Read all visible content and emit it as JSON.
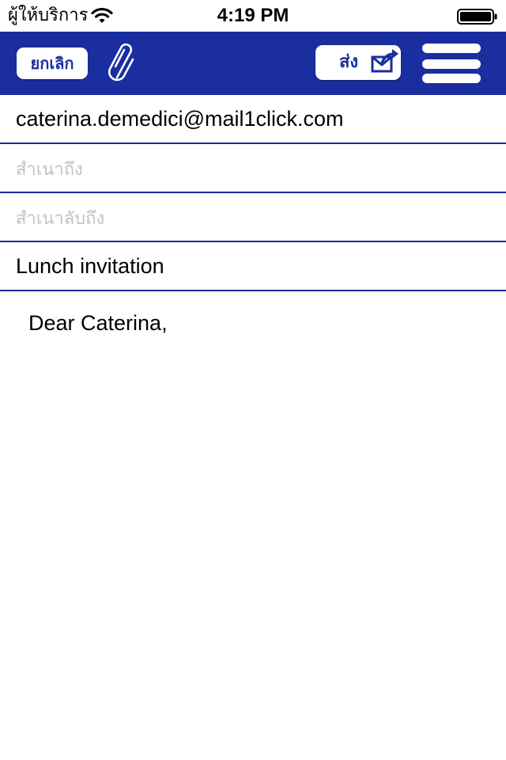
{
  "status_bar": {
    "carrier": "ผู้ให้บริการ",
    "time": "4:19 PM",
    "wifi_icon": "wifi-icon",
    "battery_icon": "battery-icon"
  },
  "toolbar": {
    "cancel_label": "ยกเลิก",
    "attach_icon": "paperclip-icon",
    "send_label": "ส่ง",
    "send_icon": "envelope-send-icon",
    "menu_icon": "hamburger-menu-icon"
  },
  "compose": {
    "to_value": "caterina.demedici@mail1click.com",
    "cc_placeholder": "สำเนาถึง",
    "bcc_placeholder": "สำเนาลับถึง",
    "subject_value": "Lunch invitation",
    "body_value": "Dear Caterina,"
  },
  "colors": {
    "brand": "#1a2ea0",
    "background": "#ffffff",
    "placeholder": "#c3c3c8"
  }
}
